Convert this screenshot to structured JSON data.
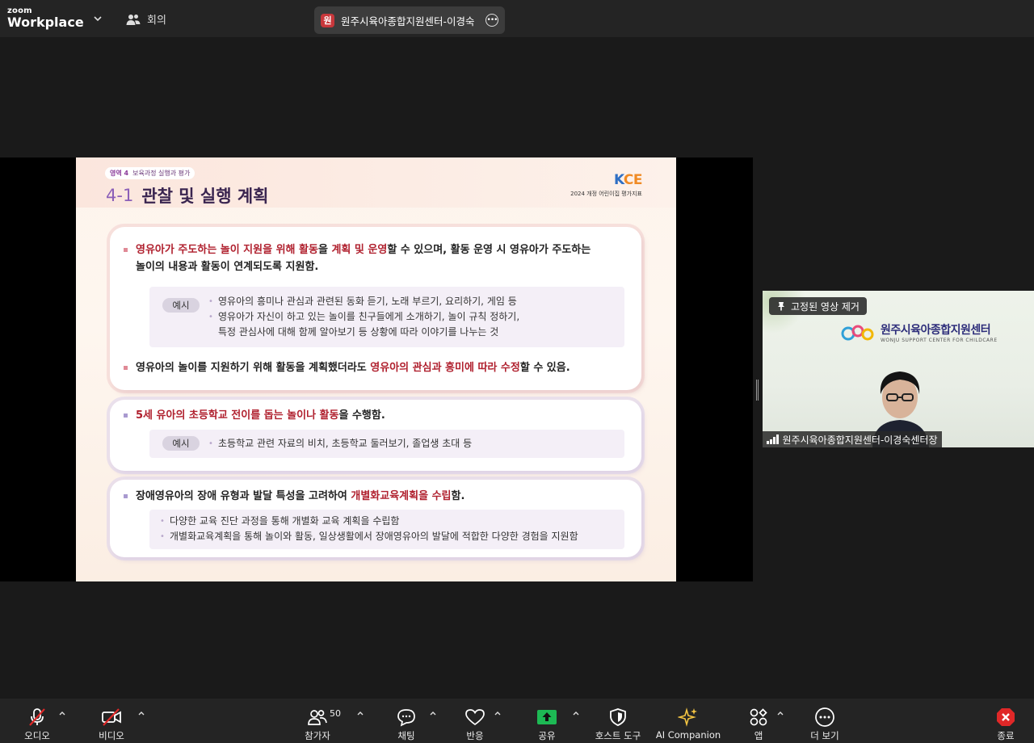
{
  "top_bar": {
    "brand_small": "zoom",
    "brand_big": "Workplace",
    "meeting_label": "회의",
    "speaker_initial": "원",
    "speaker_name": "원주시육아종합지원센터-이경숙"
  },
  "slide": {
    "tag_area": "영역 4",
    "tag_title": "보육과정 실행과 평가",
    "title_num": "4-1",
    "title_text": "관찰 및 실행 계획",
    "logo_k": "K",
    "logo_rest": "CE",
    "logo_sub": "2024 개정 어린이집 평가지표",
    "card1": {
      "b1_hl1": "영유아가 주도하는 놀이 지원을 위해 활동",
      "b1_t1": "을 ",
      "b1_hl2": "계획 및 운영",
      "b1_t2": "할 수 있으며, 활동 운영 시 영유아가 주도하는",
      "b1_line2": "놀이의 내용과 활동이 연계되도록 지원함.",
      "ex_badge": "예시",
      "ex_l1": "영유아의 흥미나 관심과 관련된 동화 듣기, 노래 부르기, 요리하기, 게임 등",
      "ex_l2": "영유아가 자신이 하고 있는 놀이를 친구들에게 소개하기, 놀이 규칙 정하기,",
      "ex_l3": "특정 관심사에 대해 함께 알아보기 등 상황에 따라 이야기를 나누는 것",
      "b2_t1": "영유아의 놀이를 지원하기 위해 활동을 계획했더라도 ",
      "b2_hl": "영유아의 관심과 흥미에 따라 수정",
      "b2_t2": "할 수 있음."
    },
    "card2": {
      "b_hl": "5세 유아의 초등학교 전이를 돕는 놀이나 활동",
      "b_t": "을 수행함.",
      "ex_badge": "예시",
      "ex_l1": "초등학교 관련 자료의 비치, 초등학교 둘러보기,  졸업생 초대 등"
    },
    "card3": {
      "b_t1": "장애영유아의 장애 유형과 발달 특성을 고려하여 ",
      "b_hl": "개별화교육계획을 수립",
      "b_t2": "함.",
      "ex_l1": "다양한 교육 진단 과정을 통해 개별화 교육 계획을 수립함",
      "ex_l2": "개별화교육계획을 통해 놀이와 활동, 일상생활에서 장애영유아의 발달에 적합한 다양한 경험을 지원함"
    }
  },
  "video": {
    "pin_label": "고정된 영상 제거",
    "center_name_kr": "원주시육아종합지원센터",
    "center_name_en": "WONJU SUPPORT CENTER FOR CHILDCARE",
    "participant_name": "원주시육아종합지원센터-이경숙센터장"
  },
  "toolbar": {
    "audio": "오디오",
    "video": "비디오",
    "participants": "참가자",
    "participants_count": "50",
    "chat": "채팅",
    "reactions": "반응",
    "share": "공유",
    "host_tools": "호스트 도구",
    "ai_companion": "AI Companion",
    "apps": "앱",
    "more": "더 보기",
    "end": "종료"
  },
  "colors": {
    "share_green": "#1db954",
    "end_red": "#e02828",
    "ai_gold": "#f4c542",
    "highlight_red": "#b0202e"
  }
}
